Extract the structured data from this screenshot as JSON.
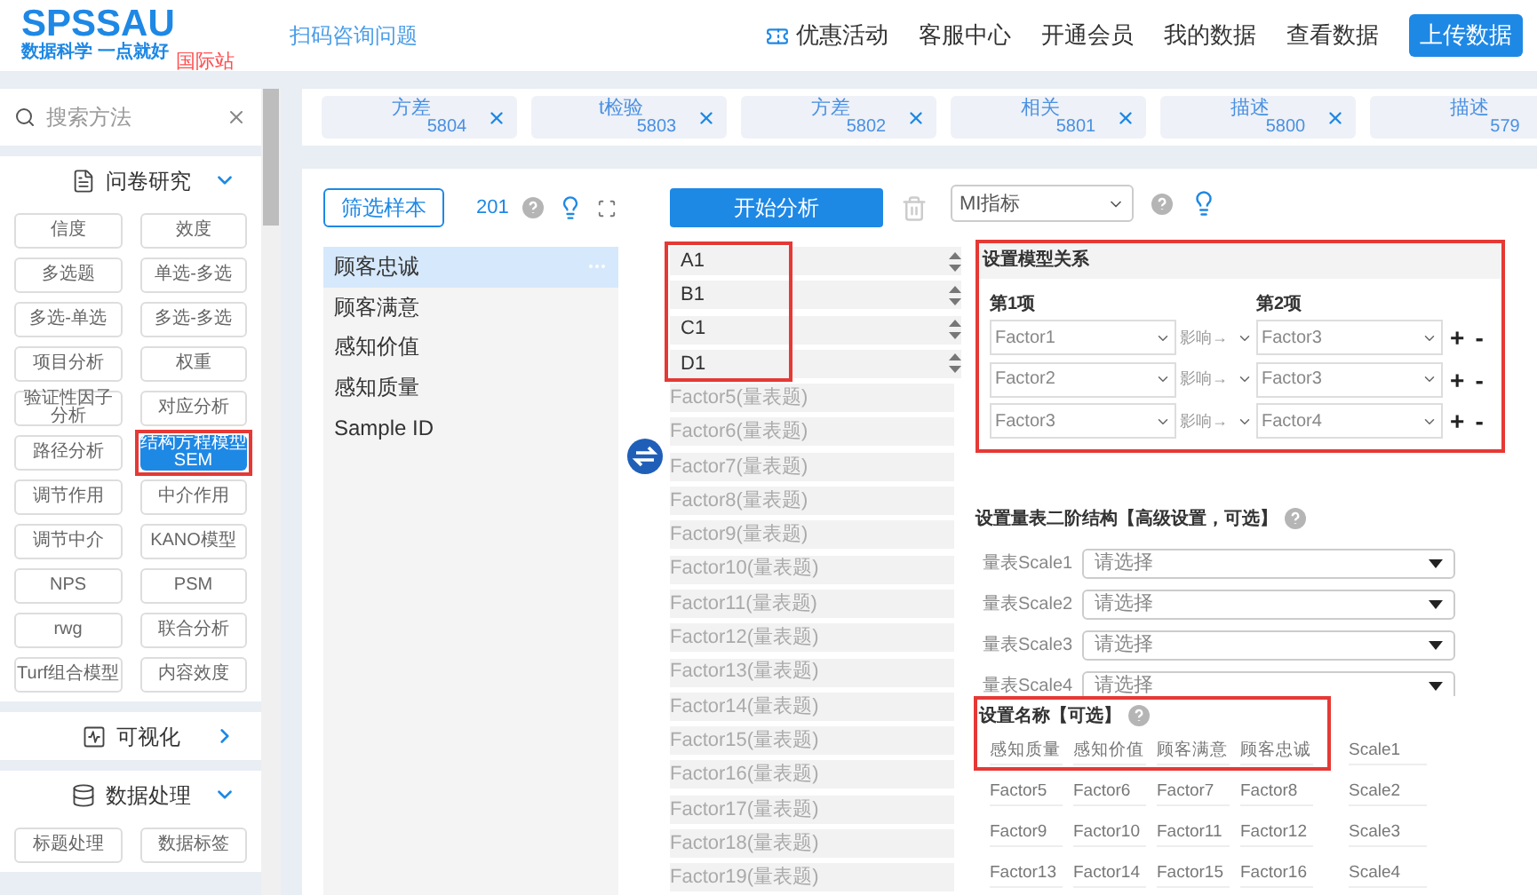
{
  "header": {
    "logo": "SPSSAU",
    "slogan": "数据科学 一点就好",
    "badge": "国际站",
    "link": "扫码咨询问题",
    "nav": [
      {
        "label": "优惠活动",
        "kind": "promo"
      },
      {
        "label": "客服中心",
        "kind": "link"
      },
      {
        "label": "开通会员",
        "kind": "link"
      },
      {
        "label": "我的数据",
        "kind": "link"
      },
      {
        "label": "查看数据",
        "kind": "link"
      }
    ],
    "upload_button": "上传数据"
  },
  "search": {
    "placeholder": "搜索方法"
  },
  "sidebar": {
    "sections": [
      {
        "title": "问卷研究",
        "kind": "list",
        "expanded": true,
        "items": [
          {
            "label": "信度",
            "selected": false,
            "highlighted": false
          },
          {
            "label": "效度",
            "selected": false,
            "highlighted": false
          },
          {
            "label": "多选题",
            "selected": false,
            "highlighted": false
          },
          {
            "label": "单选-多选",
            "selected": false,
            "highlighted": false
          },
          {
            "label": "多选-单选",
            "selected": false,
            "highlighted": false
          },
          {
            "label": "多选-多选",
            "selected": false,
            "highlighted": false
          },
          {
            "label": "项目分析",
            "selected": false,
            "highlighted": false
          },
          {
            "label": "权重",
            "selected": false,
            "highlighted": false
          },
          {
            "label": "验证性因子分析",
            "selected": false,
            "highlighted": false
          },
          {
            "label": "对应分析",
            "selected": false,
            "highlighted": false
          },
          {
            "label": "路径分析",
            "selected": false,
            "highlighted": false
          },
          {
            "label": "结构方程模型SEM",
            "selected": true,
            "highlighted": true
          },
          {
            "label": "调节作用",
            "selected": false,
            "highlighted": false
          },
          {
            "label": "中介作用",
            "selected": false,
            "highlighted": false
          },
          {
            "label": "调节中介",
            "selected": false,
            "highlighted": false
          },
          {
            "label": "KANO模型",
            "selected": false,
            "highlighted": false
          },
          {
            "label": "NPS",
            "selected": false,
            "highlighted": false
          },
          {
            "label": "PSM",
            "selected": false,
            "highlighted": false
          },
          {
            "label": "rwg",
            "selected": false,
            "highlighted": false
          },
          {
            "label": "联合分析",
            "selected": false,
            "highlighted": false
          },
          {
            "label": "Turf组合模型",
            "selected": false,
            "highlighted": false
          },
          {
            "label": "内容效度",
            "selected": false,
            "highlighted": false
          }
        ]
      },
      {
        "title": "可视化",
        "kind": "chart",
        "expanded": false
      },
      {
        "title": "数据处理",
        "kind": "data",
        "expanded": true,
        "items": [
          {
            "label": "标题处理",
            "selected": false,
            "highlighted": false
          },
          {
            "label": "数据标签",
            "selected": false,
            "highlighted": false
          }
        ]
      }
    ]
  },
  "history_tabs": [
    {
      "label": "方差",
      "number": "5804",
      "close_shown": true
    },
    {
      "label": "t检验",
      "number": "5803",
      "close_shown": true
    },
    {
      "label": "方差",
      "number": "5802",
      "close_shown": true
    },
    {
      "label": "相关",
      "number": "5801",
      "close_shown": true
    },
    {
      "label": "描述",
      "number": "5800",
      "close_shown": true
    },
    {
      "label": "描述",
      "number": "579",
      "close_shown": false
    }
  ],
  "toolbar": {
    "filter_button": "筛选样本",
    "sample_count": "201"
  },
  "variables": [
    {
      "label": "顾客忠诚",
      "selected": true
    },
    {
      "label": "顾客满意",
      "selected": false
    },
    {
      "label": "感知价值",
      "selected": false
    },
    {
      "label": "感知质量",
      "selected": false
    },
    {
      "label": "Sample ID",
      "selected": false
    }
  ],
  "start_button": "开始分析",
  "index_select": {
    "value": "MI指标"
  },
  "factor_slots": {
    "highlighted": true,
    "slots": [
      {
        "label": "A1",
        "filled": true
      },
      {
        "label": "B1",
        "filled": true
      },
      {
        "label": "C1",
        "filled": true
      },
      {
        "label": "D1",
        "filled": true
      },
      {
        "label": "Factor5(量表题)",
        "filled": false
      },
      {
        "label": "Factor6(量表题)",
        "filled": false
      },
      {
        "label": "Factor7(量表题)",
        "filled": false
      },
      {
        "label": "Factor8(量表题)",
        "filled": false
      },
      {
        "label": "Factor9(量表题)",
        "filled": false
      },
      {
        "label": "Factor10(量表题)",
        "filled": false
      },
      {
        "label": "Factor11(量表题)",
        "filled": false
      },
      {
        "label": "Factor12(量表题)",
        "filled": false
      },
      {
        "label": "Factor13(量表题)",
        "filled": false
      },
      {
        "label": "Factor14(量表题)",
        "filled": false
      },
      {
        "label": "Factor15(量表题)",
        "filled": false
      },
      {
        "label": "Factor16(量表题)",
        "filled": false
      },
      {
        "label": "Factor17(量表题)",
        "filled": false
      },
      {
        "label": "Factor18(量表题)",
        "filled": false
      },
      {
        "label": "Factor19(量表题)",
        "filled": false
      }
    ]
  },
  "model_relations": {
    "title": "设置模型关系",
    "highlighted": true,
    "column_1": "第1项",
    "column_2": "第2项",
    "rows": [
      {
        "from": "Factor1",
        "relation": "影响→",
        "to": "Factor3",
        "add": "+",
        "remove": "-"
      },
      {
        "from": "Factor2",
        "relation": "影响→",
        "to": "Factor3",
        "add": "+",
        "remove": "-"
      },
      {
        "from": "Factor3",
        "relation": "影响→",
        "to": "Factor4",
        "add": "+",
        "remove": "-"
      }
    ]
  },
  "second_order": {
    "title": "设置量表二阶结构【高级设置，可选】",
    "rows": [
      {
        "label": "量表Scale1",
        "placeholder": "请选择"
      },
      {
        "label": "量表Scale2",
        "placeholder": "请选择"
      },
      {
        "label": "量表Scale3",
        "placeholder": "请选择"
      },
      {
        "label": "量表Scale4",
        "placeholder": "请选择"
      }
    ]
  },
  "names": {
    "title": "设置名称【可选】",
    "highlighted": true,
    "rows": [
      {
        "factors": [
          "感知质量",
          "感知价值",
          "顾客满意",
          "顾客忠诚"
        ],
        "scale": "Scale1"
      },
      {
        "factors": [
          "Factor5",
          "Factor6",
          "Factor7",
          "Factor8"
        ],
        "scale": "Scale2"
      },
      {
        "factors": [
          "Factor9",
          "Factor10",
          "Factor11",
          "Factor12"
        ],
        "scale": "Scale3"
      },
      {
        "factors": [
          "Factor13",
          "Factor14",
          "Factor15",
          "Factor16"
        ],
        "scale": "Scale4"
      }
    ]
  }
}
